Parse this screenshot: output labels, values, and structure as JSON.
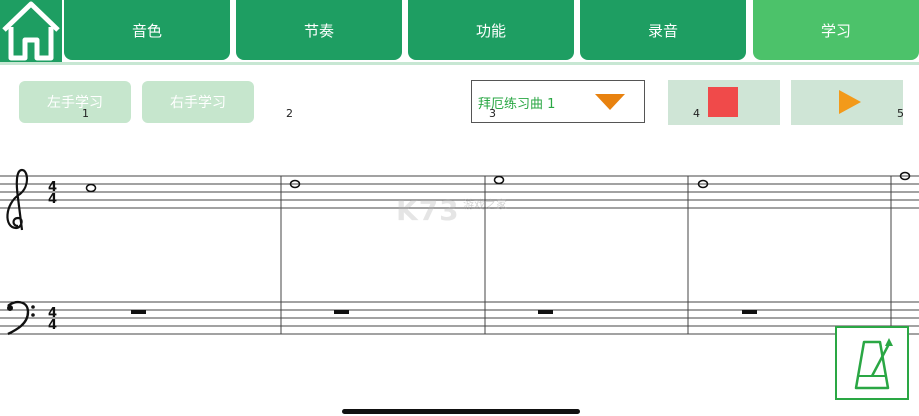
{
  "nav": {
    "home_icon": "home-icon",
    "tabs": [
      {
        "label": "音色"
      },
      {
        "label": "节奏"
      },
      {
        "label": "功能"
      },
      {
        "label": "录音"
      },
      {
        "label": "学习",
        "active": true
      }
    ]
  },
  "controls": {
    "left_hand_label": "左手学习",
    "right_hand_label": "右手学习",
    "song_select_value": "拜厄练习曲 1",
    "stop_icon": "stop-icon",
    "play_icon": "play-icon"
  },
  "score": {
    "measure_numbers": [
      "1",
      "2",
      "3",
      "4",
      "5"
    ],
    "time_signature_top": "4",
    "time_signature_bottom": "4"
  },
  "watermark": {
    "main": "K73",
    "sub": "游戏之家"
  },
  "colors": {
    "tab_bg": "#1e9e62",
    "tab_active_bg": "#4cc26a",
    "hand_button_bg": "#c6e6cd",
    "accent_green": "#2aa744",
    "stop_red": "#f04a4a",
    "play_orange": "#f39a1a",
    "dropdown_arrow": "#e8820f"
  }
}
